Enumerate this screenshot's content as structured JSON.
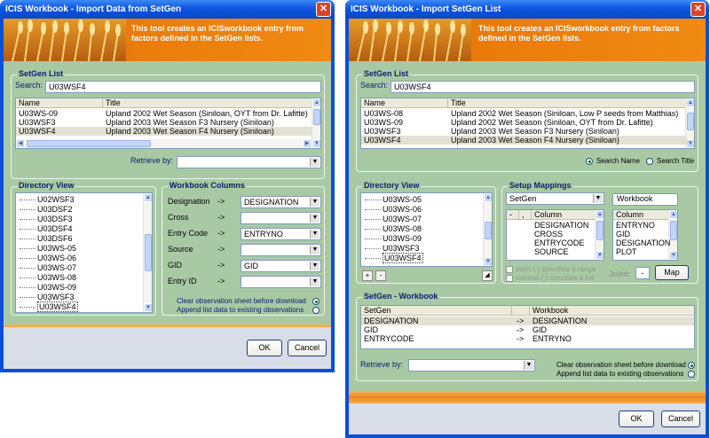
{
  "left": {
    "title": "ICIS Workbook - Import Data from SetGen",
    "close_glyph": "✕",
    "banner_text": "This tool creates an ICISworkbook entry from factors defined in the SetGen lists.",
    "setgen": {
      "title": "SetGen List",
      "search_label": "Search:",
      "search_value": "U03WSF4",
      "columns": [
        "Name",
        "Title"
      ],
      "rows": [
        {
          "name": "U03WS-09",
          "title": "Upland 2002 Wet Season (Siniloan, OYT from Dr. Lafitte)"
        },
        {
          "name": "U03WSF3",
          "title": "Upland 2003 Wet Season F3 Nursery (Siniloan)"
        },
        {
          "name": "U03WSF4",
          "title": "Upland 2003 Wet Season F4 Nursery (Siniloan)"
        }
      ],
      "retrieve_label": "Retrieve by:",
      "retrieve_value": ""
    },
    "directory": {
      "title": "Directory View",
      "items": [
        "U02WSF3",
        "U03DSF2",
        "U03DSF3",
        "U03DSF4",
        "U03DSF6",
        "U03WS-05",
        "U03WS-06",
        "U03WS-07",
        "U03WS-08",
        "U03WS-09",
        "U03WSF3",
        "U03WSF4"
      ]
    },
    "workbook_columns": {
      "title": "Workbook Columns",
      "arrow": "->",
      "rows": [
        {
          "label": "Designation",
          "value": "DESIGNATION"
        },
        {
          "label": "Cross",
          "value": ""
        },
        {
          "label": "Entry Code",
          "value": "ENTRYNO"
        },
        {
          "label": "Source",
          "value": ""
        },
        {
          "label": "GID",
          "value": "GID"
        },
        {
          "label": "Entry ID",
          "value": ""
        }
      ],
      "opt_clear": "Clear observation sheet before download",
      "opt_append": "Append list data to existing observations"
    },
    "ok": "OK",
    "cancel": "Cancel"
  },
  "right": {
    "title": "ICIS Workbook - Import SetGen List",
    "close_glyph": "✕",
    "banner_text": "This tool creates an ICISworkbook entry from factors defined in the SetGen lists.",
    "setgen": {
      "title": "SetGen List",
      "search_label": "Search:",
      "search_value": "U03WSF4",
      "columns": [
        "Name",
        "Title"
      ],
      "rows": [
        {
          "name": "U03WS-08",
          "title": "Upland 2002 Wet Season (Siniloan, Low P seeds from Matthias)"
        },
        {
          "name": "U03WS-09",
          "title": "Upland 2002 Wet Season (Siniloan, OYT from Dr. Lafitte)"
        },
        {
          "name": "U03WSF3",
          "title": "Upland 2003 Wet Season F3 Nursery (Siniloan)"
        },
        {
          "name": "U03WSF4",
          "title": "Upland 2003 Wet Season F4 Nursery (Siniloan)"
        }
      ],
      "search_name": "Search Name",
      "search_title": "Search Title"
    },
    "directory": {
      "title": "Directory View",
      "items": [
        "U03WS-05",
        "U03WS-06",
        "U03WS-07",
        "U03WS-08",
        "U03WS-09",
        "U03WSF3",
        "U03WSF4"
      ],
      "add": "+",
      "remove": "-"
    },
    "mappings": {
      "title": "Setup Mappings",
      "setgen_value": "SetGen",
      "workbook_label": "Workbook",
      "setgen_hdr_minus": "-",
      "setgen_hdr_comma": ",",
      "column_hdr": "Column",
      "setgen_columns": [
        "DESIGNATION",
        "CROSS",
        "ENTRYCODE",
        "SOURCE"
      ],
      "workbook_columns": [
        "ENTRYNO",
        "GID",
        "DESIGNATION",
        "PLOT"
      ],
      "dash_opt": "dash (-) specifies a range",
      "comma_opt": "comma (,) specifies a list",
      "joint_label": "Joint:",
      "joint_value": "-",
      "map_btn": "Map"
    },
    "sgwb": {
      "title": "SetGen - Workbook",
      "columns": [
        "SetGen",
        "Workbook"
      ],
      "rows": [
        {
          "setgen": "DESIGNATION",
          "arrow": "->",
          "workbook": "DESIGNATION"
        },
        {
          "setgen": "GID",
          "arrow": "->",
          "workbook": "GID"
        },
        {
          "setgen": "ENTRYCODE",
          "arrow": "->",
          "workbook": "ENTRYNO"
        }
      ]
    },
    "retrieve_label": "Retrieve by:",
    "retrieve_value": "",
    "opt_clear": "Clear observation sheet before download",
    "opt_append": "Append list data to existing observations",
    "ok": "OK",
    "cancel": "Cancel"
  }
}
